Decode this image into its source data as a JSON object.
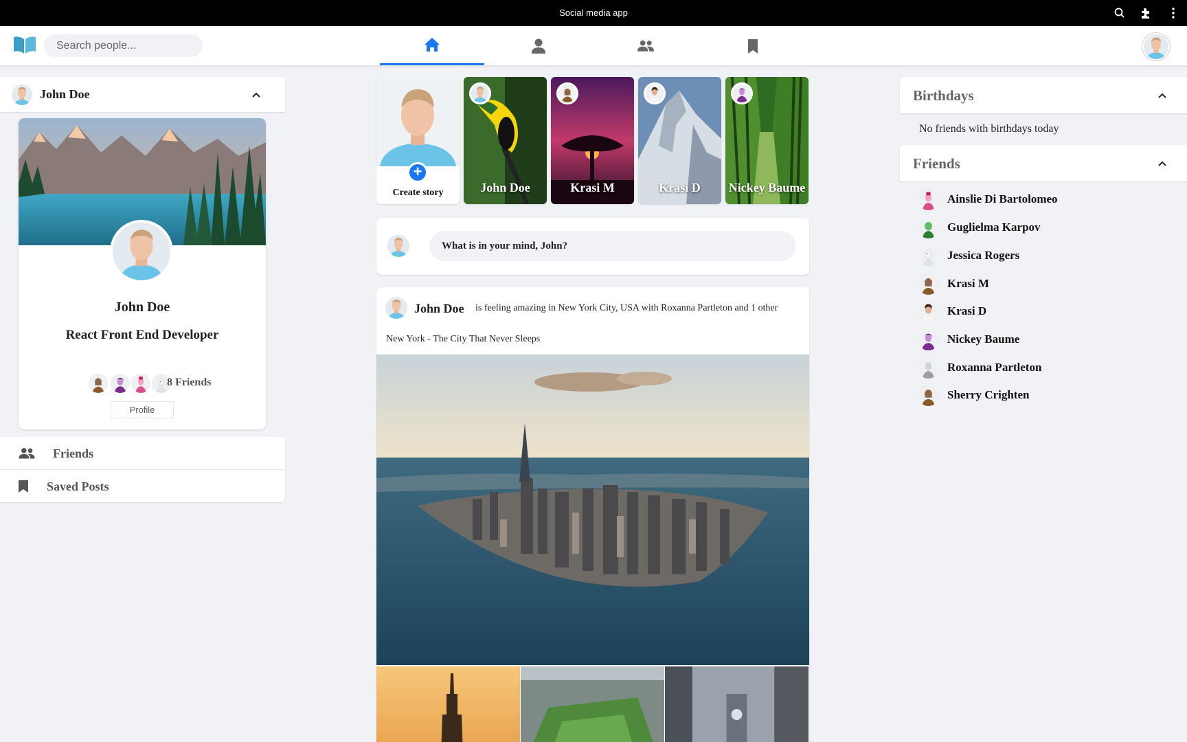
{
  "window": {
    "title": "Social media app"
  },
  "header": {
    "search_placeholder": "Search people...",
    "tabs": [
      {
        "name": "home",
        "active": true
      },
      {
        "name": "profile",
        "active": false
      },
      {
        "name": "friends",
        "active": false
      },
      {
        "name": "saved",
        "active": false
      }
    ]
  },
  "left": {
    "user_name": "John Doe",
    "profile": {
      "name": "John Doe",
      "role": "React Front End Developer",
      "friends_count": "8 Friends",
      "profile_button": "Profile"
    },
    "menu": [
      {
        "label": "Friends",
        "icon": "friends-icon"
      },
      {
        "label": "Saved Posts",
        "icon": "bookmark-icon"
      }
    ]
  },
  "stories": {
    "create_label": "Create story",
    "items": [
      {
        "name": "John Doe"
      },
      {
        "name": "Krasi M"
      },
      {
        "name": "Krasi D"
      },
      {
        "name": "Nickey Baume"
      }
    ]
  },
  "composer": {
    "prompt": "What is in your mind, John?"
  },
  "post": {
    "author": "John Doe",
    "feeling": "is feeling amazing in New York City, USA with Roxanna Partleton and 1 other",
    "caption": "New York - The City That Never Sleeps"
  },
  "right": {
    "birthdays_title": "Birthdays",
    "birthdays_empty": "No friends with birthdays today",
    "friends_title": "Friends",
    "friends": [
      "Ainslie Di Bartolomeo",
      "Guglielma Karpov",
      "Jessica Rogers",
      "Krasi M",
      "Krasi D",
      "Nickey Baume",
      "Roxanna Partleton",
      "Sherry Crighten"
    ]
  },
  "colors": {
    "accent": "#1877f2",
    "nav_icon": "#65676b",
    "background": "#f0f2f5"
  }
}
